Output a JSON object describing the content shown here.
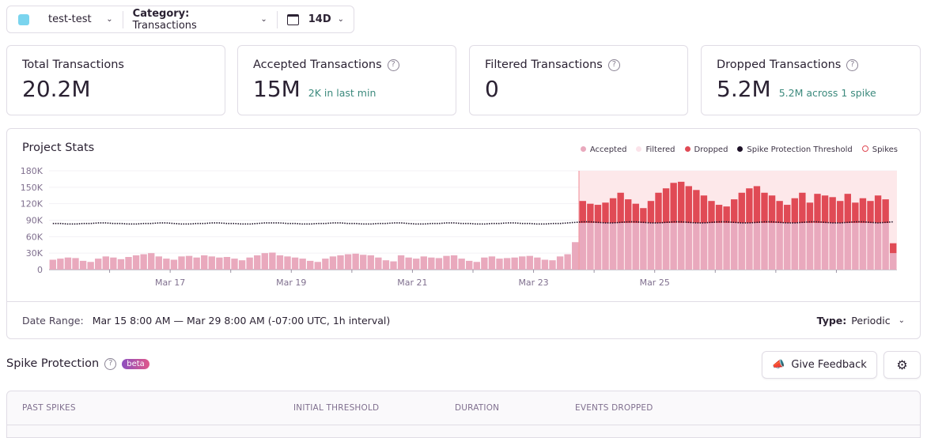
{
  "filters": {
    "project": "test-test",
    "category_label": "Category:",
    "category_value": "Transactions",
    "period": "14D"
  },
  "cards": [
    {
      "title": "Total Transactions",
      "value": "20.2M",
      "sub": "",
      "help": false
    },
    {
      "title": "Accepted Transactions",
      "value": "15M",
      "sub": "2K in last min",
      "help": true
    },
    {
      "title": "Filtered Transactions",
      "value": "0",
      "sub": "",
      "help": true
    },
    {
      "title": "Dropped Transactions",
      "value": "5.2M",
      "sub": "5.2M across 1 spike",
      "help": true
    }
  ],
  "panel": {
    "title": "Project Stats",
    "date_range_label": "Date Range:",
    "date_range_value": "Mar 15 8:00 AM — Mar 29 8:00 AM (-07:00 UTC, 1h interval)",
    "type_label": "Type:",
    "type_value": "Periodic"
  },
  "colors": {
    "accepted": "#e9a9bd",
    "filtered": "#fbe3ea",
    "dropped": "#e04a55",
    "threshold": "#1d1127",
    "spike_fill": "#fde8ea",
    "accent": "#3c8a7d"
  },
  "chart_data": {
    "type": "bar",
    "stacked": true,
    "legend": [
      "Accepted",
      "Filtered",
      "Dropped",
      "Spike Protection Threshold",
      "Spikes"
    ],
    "legend_position": "top-right",
    "yticks": [
      "0",
      "30K",
      "60K",
      "90K",
      "120K",
      "150K",
      "180K"
    ],
    "ylim": [
      0,
      180000
    ],
    "xlabels": [
      "Mar 17",
      "Mar 19",
      "Mar 21",
      "Mar 23",
      "Mar 25"
    ],
    "bin_hours": 3,
    "accepted": [
      18000,
      20000,
      22000,
      21000,
      16000,
      14000,
      20000,
      24000,
      22000,
      19000,
      23000,
      26000,
      28000,
      30000,
      24000,
      20000,
      18000,
      24000,
      25000,
      22000,
      26000,
      24000,
      22000,
      23000,
      20000,
      17000,
      22000,
      26000,
      30000,
      31000,
      26000,
      24000,
      22000,
      20000,
      16000,
      14000,
      20000,
      24000,
      26000,
      28000,
      29000,
      27000,
      26000,
      22000,
      17000,
      15000,
      26000,
      22000,
      20000,
      24000,
      22000,
      21000,
      25000,
      26000,
      20000,
      16000,
      14000,
      22000,
      24000,
      20000,
      21000,
      22000,
      24000,
      25000,
      22000,
      18000,
      17000,
      24000,
      28000,
      50000,
      85000,
      85000,
      85000,
      85000,
      85000,
      85000,
      85000,
      85000,
      85000,
      85000,
      85000,
      85000,
      85000,
      85000,
      85000,
      85000,
      85000,
      85000,
      85000,
      85000,
      85000,
      85000,
      85000,
      85000,
      85000,
      85000,
      85000,
      85000,
      85000,
      85000,
      85000,
      85000,
      85000,
      85000,
      85000,
      85000,
      85000,
      85000,
      85000,
      85000,
      85000,
      30000
    ],
    "filtered": 0,
    "dropped": [
      0,
      0,
      0,
      0,
      0,
      0,
      0,
      0,
      0,
      0,
      0,
      0,
      0,
      0,
      0,
      0,
      0,
      0,
      0,
      0,
      0,
      0,
      0,
      0,
      0,
      0,
      0,
      0,
      0,
      0,
      0,
      0,
      0,
      0,
      0,
      0,
      0,
      0,
      0,
      0,
      0,
      0,
      0,
      0,
      0,
      0,
      0,
      0,
      0,
      0,
      0,
      0,
      0,
      0,
      0,
      0,
      0,
      0,
      0,
      0,
      0,
      0,
      0,
      0,
      0,
      0,
      0,
      0,
      0,
      0,
      40000,
      35000,
      33000,
      37000,
      45000,
      55000,
      43000,
      35000,
      27000,
      40000,
      55000,
      63000,
      73000,
      75000,
      67000,
      60000,
      50000,
      40000,
      33000,
      30000,
      43000,
      55000,
      63000,
      67000,
      55000,
      50000,
      40000,
      33000,
      45000,
      55000,
      37000,
      53000,
      50000,
      47000,
      40000,
      53000,
      37000,
      45000,
      40000,
      50000,
      43000,
      18000
    ],
    "threshold": [
      84000,
      84000,
      83000,
      83000,
      84000,
      84000,
      85000,
      85000,
      84000,
      84000,
      83000,
      83000,
      84000,
      84000,
      85000,
      85000,
      84000,
      83000,
      83000,
      84000,
      84000,
      85000,
      85000,
      84000,
      84000,
      83000,
      83000,
      84000,
      85000,
      85000,
      85000,
      84000,
      84000,
      83000,
      83000,
      84000,
      84000,
      85000,
      85000,
      84000,
      84000,
      83000,
      83000,
      84000,
      84000,
      85000,
      85000,
      84000,
      83000,
      83000,
      84000,
      84000,
      85000,
      85000,
      84000,
      84000,
      83000,
      83000,
      84000,
      84000,
      85000,
      85000,
      84000,
      84000,
      83000,
      83000,
      84000,
      84000,
      85000,
      86000,
      87000,
      87000,
      86000,
      85000,
      85000,
      86000,
      87000,
      87000,
      86000,
      85000,
      85000,
      86000,
      87000,
      87000,
      86000,
      85000,
      85000,
      86000,
      87000,
      87000,
      86000,
      85000,
      85000,
      86000,
      87000,
      87000,
      86000,
      85000,
      85000,
      86000,
      87000,
      87000,
      86000,
      85000,
      85000,
      86000,
      87000,
      87000,
      86000,
      85000,
      86000,
      87000
    ],
    "spike_start_index": 70
  },
  "spike": {
    "title": "Spike Protection",
    "badge": "beta",
    "feedback": "Give Feedback"
  },
  "table": {
    "columns": [
      "PAST SPIKES",
      "INITIAL THRESHOLD",
      "DURATION",
      "EVENTS DROPPED"
    ]
  }
}
